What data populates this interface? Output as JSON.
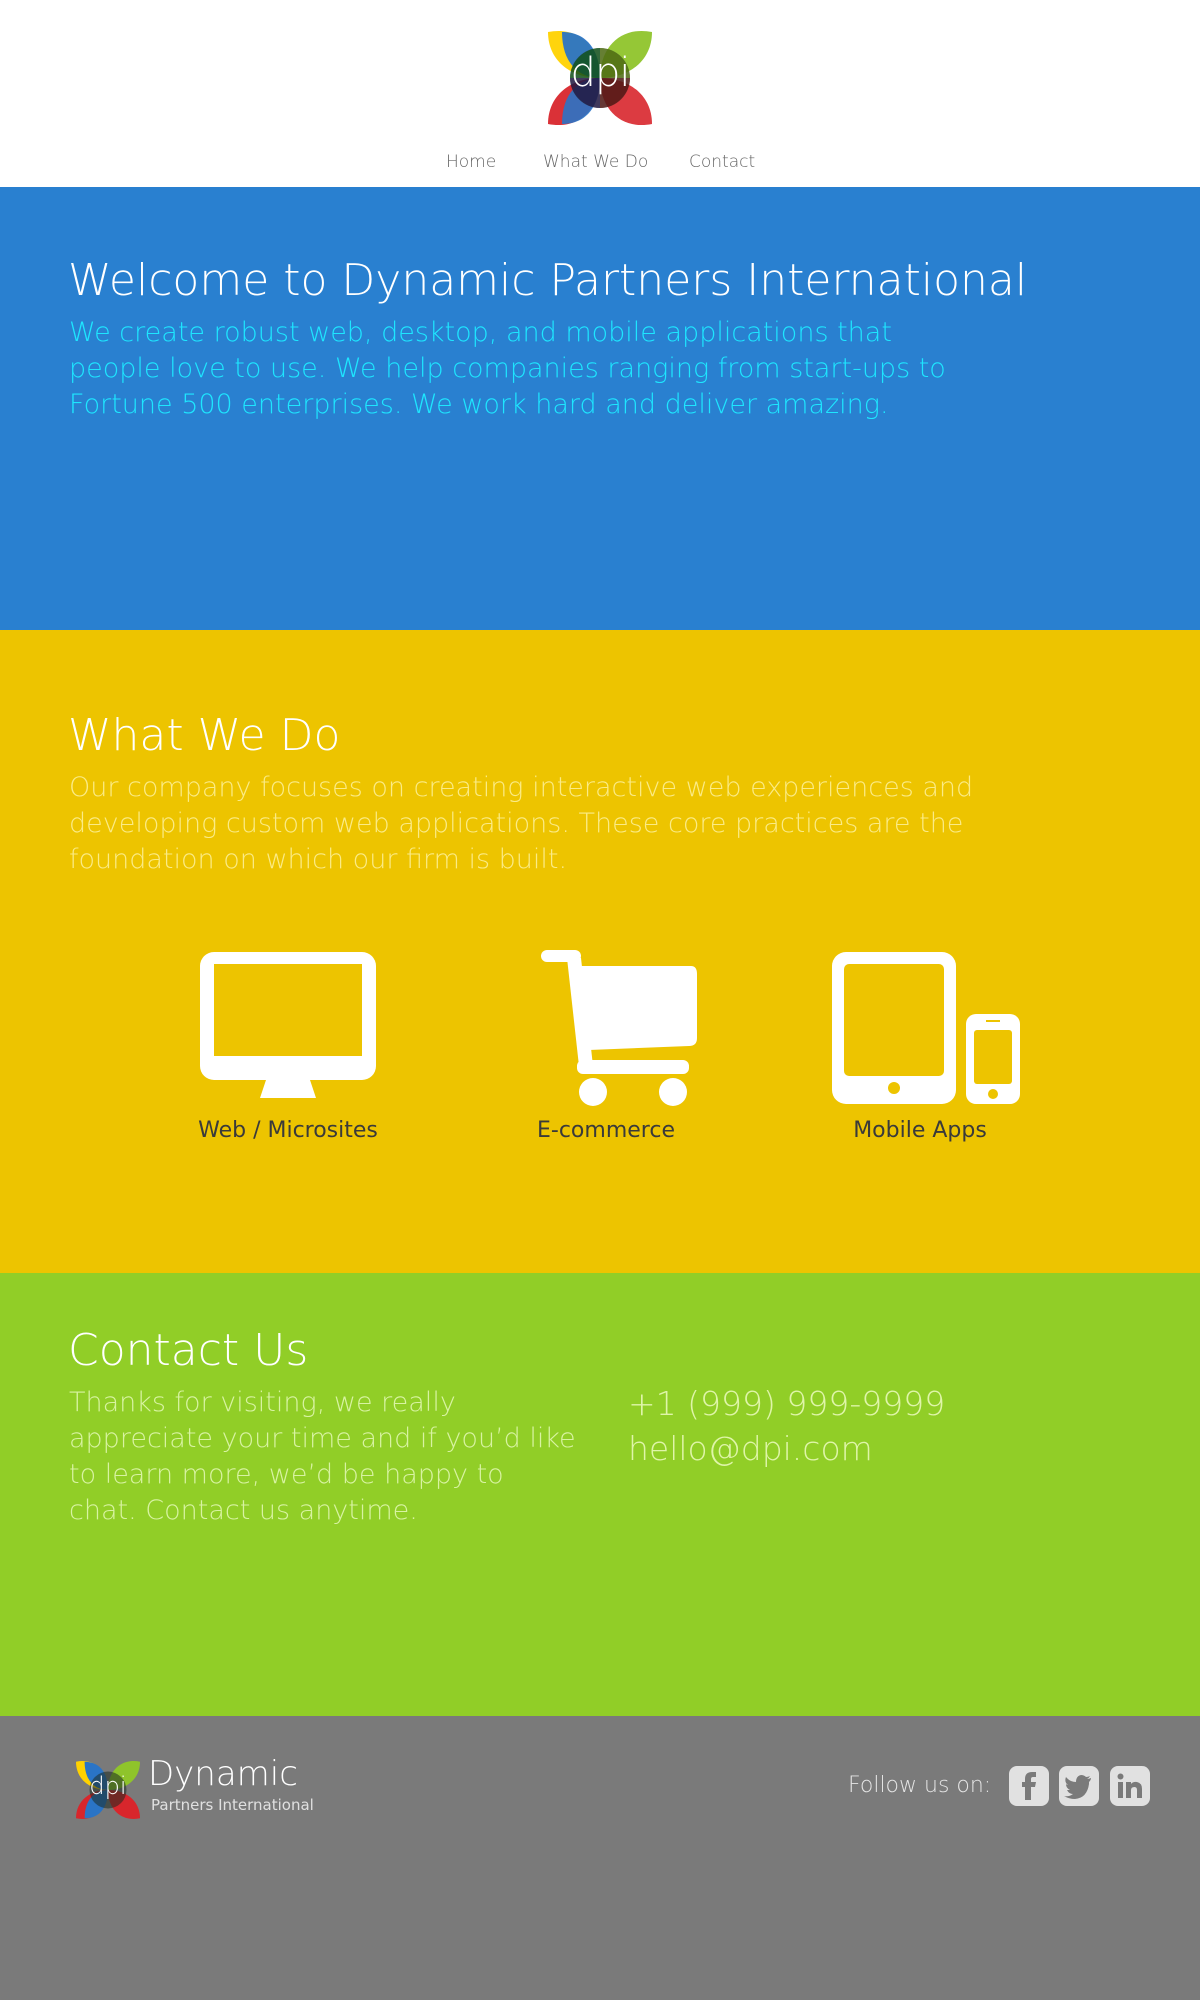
{
  "header": {
    "logo_text": "dpi",
    "nav": [
      "Home",
      "What We Do",
      "Contact"
    ]
  },
  "hero": {
    "title": "Welcome to Dynamic Partners International",
    "text": "We create robust web, desktop, and mobile applications that people love to use. We help companies ranging from start-ups to Fortune 500 enterprises. We work hard and deliver amazing."
  },
  "what": {
    "title": "What We Do",
    "text": "Our company focuses on creating interactive web experiences and developing custom web applications. These core practices are the foundation on which our firm is built.",
    "services": [
      {
        "label": "Web / Microsites",
        "icon": "monitor-icon"
      },
      {
        "label": "E-commerce",
        "icon": "shopping-cart-icon"
      },
      {
        "label": "Mobile Apps",
        "icon": "tablet-phone-icon"
      }
    ]
  },
  "contact": {
    "title": "Contact Us",
    "text": "Thanks for visiting, we really appreciate your time and if you’d like to learn more, we’d be happy to chat. Contact us anytime.",
    "phone": "+1 (999) 999-9999",
    "email": "hello@dpi.com"
  },
  "footer": {
    "logo_text": "dpi",
    "brand_name": "Dynamic",
    "brand_sub": "Partners International",
    "follow_label": "Follow us on:",
    "social": [
      "facebook-icon",
      "twitter-icon",
      "linkedin-icon"
    ]
  },
  "colors": {
    "hero_bg": "#2980d0",
    "what_bg": "#edc400",
    "contact_bg": "#91ce27",
    "footer_bg": "#7a7a7a",
    "hero_text": "#1ee6ff"
  }
}
